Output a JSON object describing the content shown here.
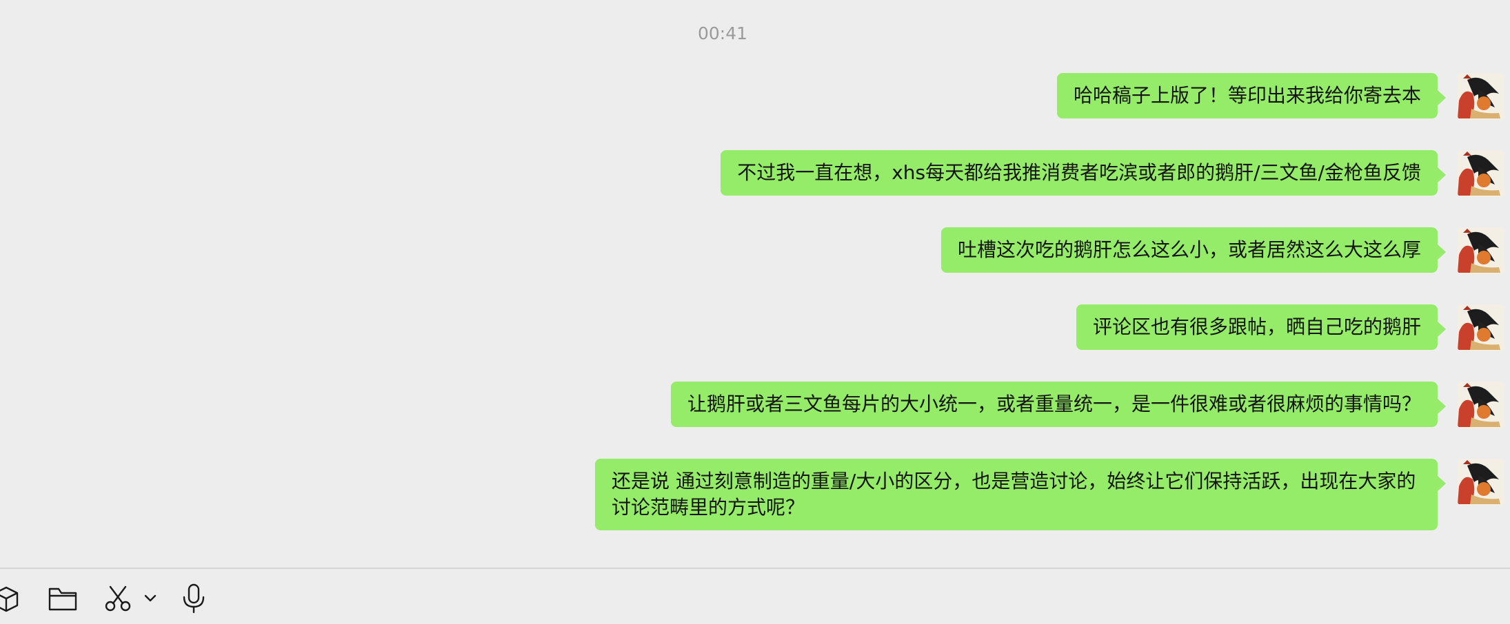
{
  "chat": {
    "timestamp": "00:41",
    "messages": [
      {
        "text": "哈哈稿子上版了！等印出来我给你寄去本"
      },
      {
        "text": "不过我一直在想，xhs每天都给我推消费者吃滨或者郎的鹅肝/三文鱼/金枪鱼反馈"
      },
      {
        "text": "吐槽这次吃的鹅肝怎么这么小，或者居然这么大这么厚"
      },
      {
        "text": "评论区也有很多跟帖，晒自己吃的鹅肝"
      },
      {
        "text": "让鹅肝或者三文鱼每片的大小统一，或者重量统一，是一件很难或者很麻烦的事情吗？"
      },
      {
        "text": "还是说 通过刻意制造的重量/大小的区分，也是营造讨论，始终让它们保持活跃，出现在大家的讨论范畴里的方式呢？"
      }
    ]
  },
  "toolbar": {
    "icons": [
      "box-icon",
      "folder-icon",
      "scissors-icon",
      "chevron-down-icon",
      "microphone-icon"
    ]
  },
  "colors": {
    "background": "#ededed",
    "bubble_self": "#95ec69",
    "timestamp_text": "#9a9a9a"
  }
}
